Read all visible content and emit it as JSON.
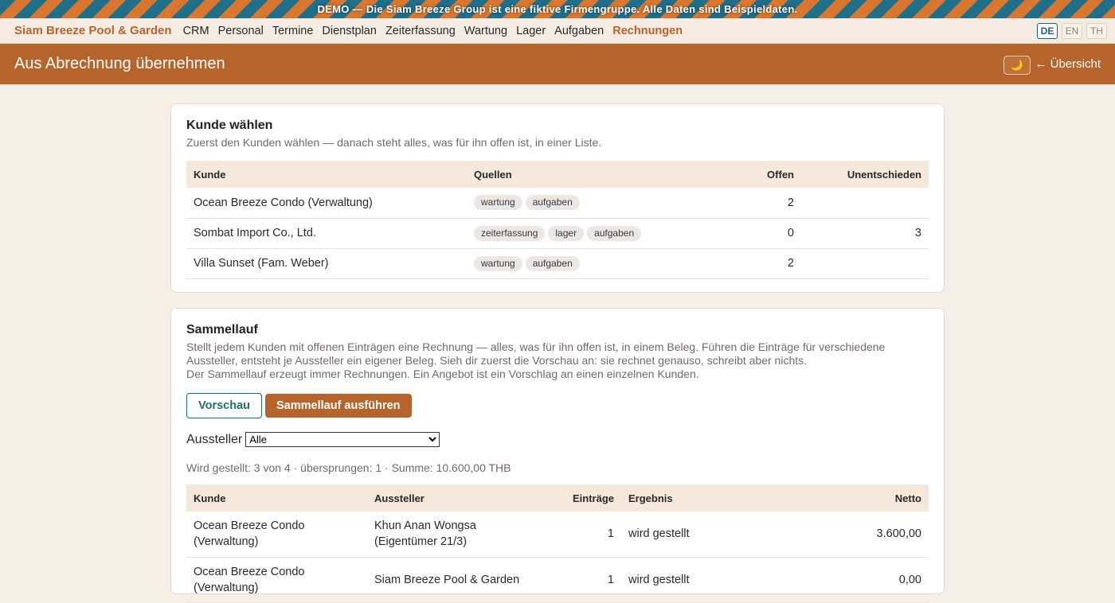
{
  "banner": "DEMO — Die Siam Breeze Group ist eine fiktive Firmengruppe. Alle Daten sind Beispieldaten.",
  "nav": {
    "brand": "Siam Breeze Pool & Garden",
    "links": [
      "CRM",
      "Personal",
      "Termine",
      "Dienstplan",
      "Zeiterfassung",
      "Wartung",
      "Lager",
      "Aufgaben",
      "Rechnungen"
    ],
    "active": "Rechnungen",
    "languages": [
      "DE",
      "EN",
      "TH"
    ],
    "active_language": "DE"
  },
  "header": {
    "title": "Aus Abrechnung übernehmen",
    "theme_icon": "moon-icon",
    "back_label": "← Übersicht"
  },
  "customer_card": {
    "title": "Kunde wählen",
    "subtitle": "Zuerst den Kunden wählen — danach steht alles, was für ihn offen ist, in einer Liste.",
    "columns": [
      "Kunde",
      "Quellen",
      "Offen",
      "Unentschieden"
    ],
    "rows": [
      {
        "kunde": "Ocean Breeze Condo (Verwaltung)",
        "quellen": [
          "wartung",
          "aufgaben"
        ],
        "offen": "2",
        "unentschieden": ""
      },
      {
        "kunde": "Sombat Import Co., Ltd.",
        "quellen": [
          "zeiterfassung",
          "lager",
          "aufgaben"
        ],
        "offen": "0",
        "unentschieden": "3"
      },
      {
        "kunde": "Villa Sunset (Fam. Weber)",
        "quellen": [
          "wartung",
          "aufgaben"
        ],
        "offen": "2",
        "unentschieden": ""
      }
    ]
  },
  "batch_card": {
    "title": "Sammellauf",
    "desc1": "Stellt jedem Kunden mit offenen Einträgen eine Rechnung — alles, was für ihn offen ist, in einem Beleg. Führen die Einträge für verschiedene Aussteller, entsteht je Aussteller ein eigener Beleg. Sieh dir zuerst die Vorschau an: sie rechnet genauso, schreibt aber nichts.",
    "desc2": "Der Sammellauf erzeugt immer Rechnungen. Ein Angebot ist ein Vorschlag an einen einzelnen Kunden.",
    "preview_label": "Vorschau",
    "run_label": "Sammellauf ausführen",
    "filter_label": "Aussteller",
    "filter_value": "Alle",
    "summary": "Wird gestellt: 3 von 4 · übersprungen: 1 · Summe: 10.600,00 THB",
    "columns": [
      "Kunde",
      "Aussteller",
      "Einträge",
      "Ergebnis",
      "Netto"
    ],
    "rows": [
      {
        "kunde": "Ocean Breeze Condo (Verwaltung)",
        "aussteller": "Khun Anan Wongsa (Eigentümer 21/3)",
        "eintraege": "1",
        "ergebnis": "wird gestellt",
        "netto": "3.600,00"
      },
      {
        "kunde": "Ocean Breeze Condo (Verwaltung)",
        "aussteller": "Siam Breeze Pool & Garden",
        "eintraege": "1",
        "ergebnis": "wird gestellt",
        "netto": "0,00"
      }
    ]
  }
}
